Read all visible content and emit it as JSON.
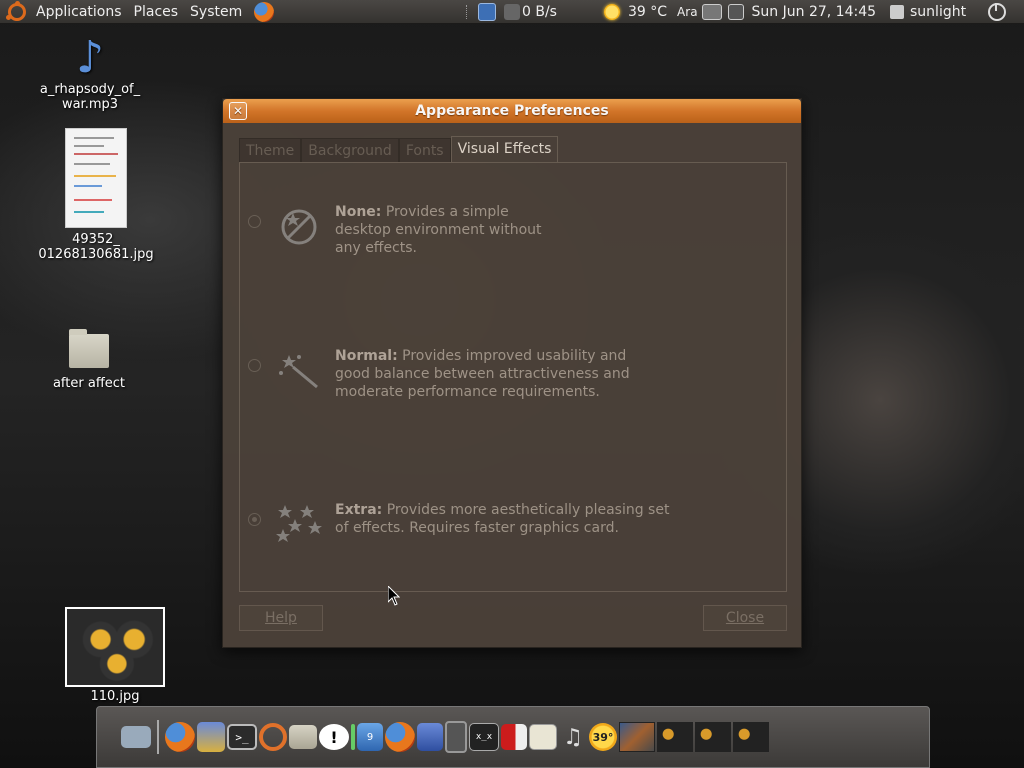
{
  "top_panel": {
    "menus": [
      "Applications",
      "Places",
      "System"
    ],
    "network_speed": "0 B/s",
    "temperature": "39 °C",
    "keyboard_layout": "Ara",
    "datetime": "Sun Jun 27, 14:45",
    "user": "sunlight"
  },
  "desktop": {
    "icons": [
      {
        "label_line1": "a_rhapsody_of_",
        "label_line2": "war.mp3"
      },
      {
        "label_line1": "49352_",
        "label_line2": "01268130681.jpg"
      },
      {
        "label_line1": "after affect"
      },
      {
        "label_line1": "110.jpg"
      }
    ]
  },
  "dialog": {
    "title": "Appearance Preferences",
    "tabs": [
      "Theme",
      "Background",
      "Fonts",
      "Visual Effects"
    ],
    "active_tab": "Visual Effects",
    "options": [
      {
        "title": "None:",
        "description_lines": [
          "Provides a simple",
          "desktop environment without",
          "any effects."
        ],
        "selected": false
      },
      {
        "title": "Normal:",
        "description_lines": [
          "Provides improved usability and",
          "good balance between attractiveness and",
          "moderate performance requirements."
        ],
        "selected": false
      },
      {
        "title": "Extra:",
        "description_lines": [
          "Provides more aesthetically pleasing set",
          "of effects. Requires faster graphics card."
        ],
        "selected": true
      }
    ],
    "help_label": "Help",
    "close_label": "Close"
  },
  "dock": {
    "calendar_day": "9",
    "weather_temp": "39°"
  },
  "colors": {
    "titlebar": "#e0823a",
    "dialog_bg": "#4b4139",
    "panel_bg": "#3f3d3a"
  }
}
